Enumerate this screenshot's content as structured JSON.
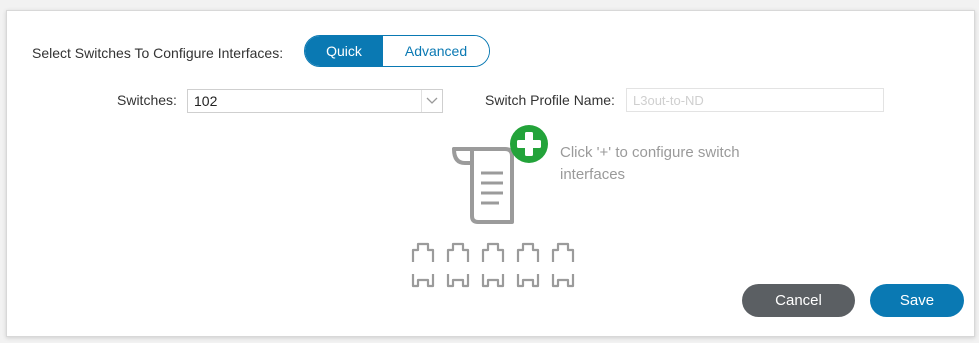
{
  "form": {
    "switch_select_label": "Select Switches To Configure Interfaces:",
    "mode_toggle": {
      "quick": "Quick",
      "advanced": "Advanced",
      "selected": "Quick"
    },
    "switches_label": "Switches:",
    "switches_value": "102",
    "profile_label": "Switch Profile Name:",
    "profile_value": "L3out-to-ND"
  },
  "hint": "Click '+' to configure switch interfaces",
  "icons": {
    "add": "plus-circle-icon",
    "illustration": "switch-config-icon",
    "dropdown": "chevron-down-icon"
  },
  "colors": {
    "accent": "#0a79b3",
    "add_green": "#23a33a",
    "cancel": "#5b5f63"
  },
  "buttons": {
    "cancel": "Cancel",
    "save": "Save"
  }
}
